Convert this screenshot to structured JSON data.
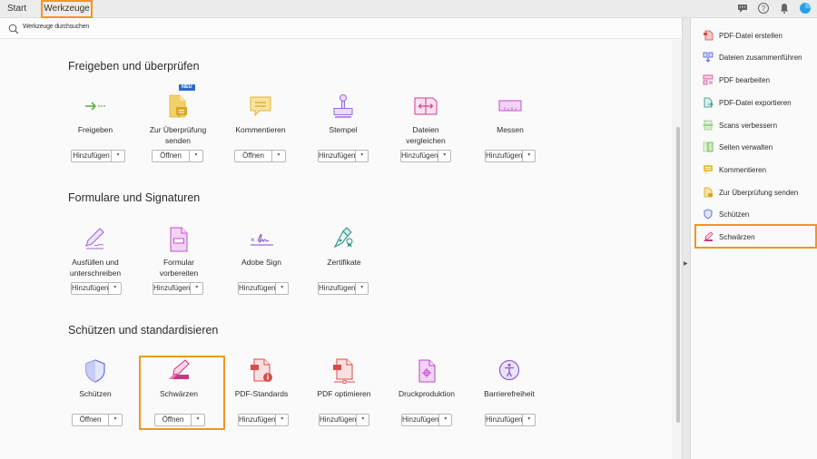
{
  "topbar": {
    "tabs": [
      {
        "label": "Start",
        "active": false
      },
      {
        "label": "Werkzeuge",
        "active": true
      }
    ],
    "icons": [
      "chat-icon",
      "help-icon",
      "bell-icon",
      "user-avatar-icon"
    ]
  },
  "search": {
    "placeholder": "Werkzeuge durchsuchen"
  },
  "sections": [
    {
      "title": "Freigeben und überprüfen",
      "tools": [
        {
          "label": "Freigeben",
          "button": "Hinzufügen",
          "icon": "share-arrow-icon"
        },
        {
          "label": "Zur Überprüfung senden",
          "button": "Öffnen",
          "icon": "send-for-review-icon",
          "badge": "NEU"
        },
        {
          "label": "Kommentieren",
          "button": "Öffnen",
          "icon": "comment-icon"
        },
        {
          "label": "Stempel",
          "button": "Hinzufügen",
          "icon": "stamp-icon"
        },
        {
          "label": "Dateien vergleichen",
          "button": "Hinzufügen",
          "icon": "compare-files-icon"
        },
        {
          "label": "Messen",
          "button": "Hinzufügen",
          "icon": "ruler-icon"
        }
      ]
    },
    {
      "title": "Formulare und Signaturen",
      "tools": [
        {
          "label": "Ausfüllen und unterschreiben",
          "button": "Hinzufügen",
          "icon": "fill-sign-icon"
        },
        {
          "label": "Formular vorbereiten",
          "button": "Hinzufügen",
          "icon": "prepare-form-icon"
        },
        {
          "label": "Adobe Sign",
          "button": "Hinzufügen",
          "icon": "adobe-sign-icon"
        },
        {
          "label": "Zertifikate",
          "button": "Hinzufügen",
          "icon": "certificate-pen-icon"
        }
      ]
    },
    {
      "title": "Schützen und standardisieren",
      "tools": [
        {
          "label": "Schützen",
          "button": "Öffnen",
          "icon": "shield-icon"
        },
        {
          "label": "Schwärzen",
          "button": "Öffnen",
          "icon": "redact-icon",
          "highlighted": true
        },
        {
          "label": "PDF-Standards",
          "button": "Hinzufügen",
          "icon": "pdf-standards-icon"
        },
        {
          "label": "PDF optimieren",
          "button": "Hinzufügen",
          "icon": "optimize-pdf-icon"
        },
        {
          "label": "Druckproduktion",
          "button": "Hinzufügen",
          "icon": "print-production-icon"
        },
        {
          "label": "Barrierefreiheit",
          "button": "Hinzufügen",
          "icon": "accessibility-icon"
        }
      ]
    }
  ],
  "right_panel": {
    "items": [
      {
        "label": "PDF-Datei erstellen",
        "icon": "create-pdf-icon"
      },
      {
        "label": "Dateien zusammenführen",
        "icon": "combine-files-icon"
      },
      {
        "label": "PDF bearbeiten",
        "icon": "edit-pdf-icon"
      },
      {
        "label": "PDF-Datei exportieren",
        "icon": "export-pdf-icon"
      },
      {
        "label": "Scans verbessern",
        "icon": "enhance-scans-icon"
      },
      {
        "label": "Seiten verwalten",
        "icon": "organize-pages-icon"
      },
      {
        "label": "Kommentieren",
        "icon": "comment-icon"
      },
      {
        "label": "Zur Überprüfung senden",
        "icon": "send-for-review-icon"
      },
      {
        "label": "Schützen",
        "icon": "shield-icon"
      },
      {
        "label": "Schwärzen",
        "icon": "redact-icon",
        "highlighted": true
      }
    ]
  },
  "colors": {
    "highlight": "#f29623",
    "badge": "#2d6bc9"
  }
}
